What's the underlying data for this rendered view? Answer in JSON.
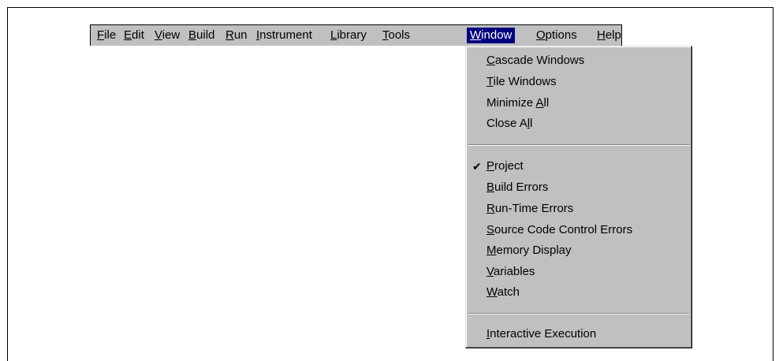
{
  "menubar": {
    "items": [
      {
        "label": "File",
        "mnemonic": "F",
        "rest": "ile"
      },
      {
        "label": "Edit",
        "mnemonic": "E",
        "rest": "dit"
      },
      {
        "label": "View",
        "mnemonic": "V",
        "rest": "iew"
      },
      {
        "label": "Build",
        "mnemonic": "B",
        "rest": "uild"
      },
      {
        "label": "Run",
        "mnemonic": "R",
        "rest": "un"
      },
      {
        "label": "Instrument",
        "mnemonic": "I",
        "rest": "nstrument"
      },
      {
        "label": "Library",
        "mnemonic": "L",
        "rest": "ibrary"
      },
      {
        "label": "Tools",
        "mnemonic": "T",
        "rest": "ools"
      },
      {
        "label": "Window",
        "mnemonic": "W",
        "rest": "indow",
        "active": true
      },
      {
        "label": "Options",
        "mnemonic": "O",
        "rest": "ptions"
      },
      {
        "label": "Help",
        "mnemonic": "H",
        "rest": "elp"
      }
    ]
  },
  "window_menu": {
    "group1": [
      {
        "pre": "",
        "mnemonic": "C",
        "rest": "ascade Windows"
      },
      {
        "pre": "",
        "mnemonic": "T",
        "rest": "ile Windows"
      },
      {
        "pre": "Minimize ",
        "mnemonic": "A",
        "rest": "ll"
      },
      {
        "pre": "Close A",
        "mnemonic": "l",
        "rest": "l"
      }
    ],
    "group2": [
      {
        "pre": "",
        "mnemonic": "P",
        "rest": "roject",
        "checked": true
      },
      {
        "pre": "",
        "mnemonic": "B",
        "rest": "uild Errors"
      },
      {
        "pre": "",
        "mnemonic": "R",
        "rest": "un-Time Errors"
      },
      {
        "pre": "",
        "mnemonic": "S",
        "rest": "ource Code Control Errors"
      },
      {
        "pre": "",
        "mnemonic": "M",
        "rest": "emory Display"
      },
      {
        "pre": "",
        "mnemonic": "V",
        "rest": "ariables"
      },
      {
        "pre": "",
        "mnemonic": "W",
        "rest": "atch"
      }
    ],
    "group3": [
      {
        "pre": "",
        "mnemonic": "I",
        "rest": "nteractive Execution"
      }
    ],
    "check_glyph": "✔"
  }
}
